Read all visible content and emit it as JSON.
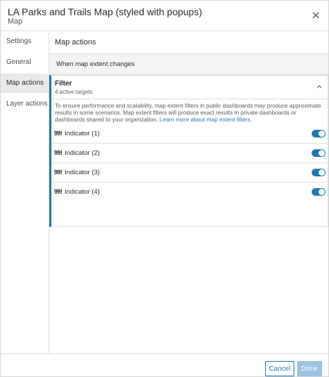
{
  "header": {
    "title": "LA Parks and Trails Map (styled with popups)",
    "subtitle": "Map",
    "close_icon": "close-icon"
  },
  "sidebar": {
    "items": [
      {
        "label": "Settings",
        "active": false
      },
      {
        "label": "General",
        "active": false
      },
      {
        "label": "Map actions",
        "active": true
      },
      {
        "label": "Layer actions",
        "active": false
      }
    ]
  },
  "main": {
    "title": "Map actions",
    "section_label": "When map extent changes",
    "filter": {
      "title": "Filter",
      "subtitle": "4 active targets",
      "chevron_icon": "chevron-up-icon",
      "notice_text": "To ensure performance and scalability, map extent filters in public dashboards may produce approximate results in some scenarios. Map extent filters will produce exact results in private dashboards or dashboards shared to your organization.",
      "notice_link": "Learn more about map extent filters.",
      "indicators": [
        {
          "icon": "99!",
          "label": "Indicator (1)",
          "enabled": true
        },
        {
          "icon": "99!",
          "label": "Indicator (2)",
          "enabled": true
        },
        {
          "icon": "99!",
          "label": "Indicator (3)",
          "enabled": true
        },
        {
          "icon": "99!",
          "label": "Indicator (4)",
          "enabled": true
        }
      ]
    }
  },
  "footer": {
    "cancel_label": "Cancel",
    "done_label": "Done"
  },
  "colors": {
    "accent": "#1f78b4",
    "active_bg": "#eaeaea",
    "done_disabled": "#9dc3e0"
  }
}
